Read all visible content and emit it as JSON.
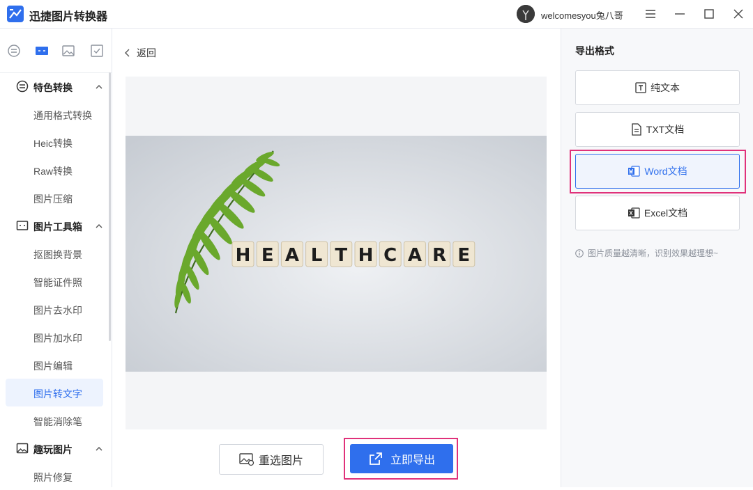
{
  "app": {
    "title": "迅捷图片转换器",
    "username": "welcomesyou兔八哥"
  },
  "window_controls": [
    "menu-icon",
    "minimize-icon",
    "maximize-icon",
    "close-icon"
  ],
  "sidebar": {
    "top_icons": [
      "convert-icon",
      "toolbox-icon",
      "image-fun-icon",
      "checklist-icon"
    ],
    "groups": [
      {
        "label": "特色转换",
        "icon": "convert-icon",
        "items": [
          "通用格式转换",
          "Heic转换",
          "Raw转换",
          "图片压缩"
        ]
      },
      {
        "label": "图片工具箱",
        "icon": "toolbox-icon",
        "items": [
          "抠图换背景",
          "智能证件照",
          "图片去水印",
          "图片加水印",
          "图片编辑",
          "图片转文字",
          "智能消除笔"
        ]
      },
      {
        "label": "趣玩图片",
        "icon": "image-fun-icon",
        "items": [
          "照片修复"
        ]
      }
    ],
    "active_item": "图片转文字"
  },
  "main": {
    "back_label": "返回",
    "photo_text": "HEALTHCARE",
    "reselect_label": "重选图片",
    "export_label": "立即导出"
  },
  "right_panel": {
    "title": "导出格式",
    "formats": [
      {
        "label": "纯文本",
        "icon": "text-icon"
      },
      {
        "label": "TXT文档",
        "icon": "txt-file-icon"
      },
      {
        "label": "Word文档",
        "icon": "word-icon"
      },
      {
        "label": "Excel文档",
        "icon": "excel-icon"
      }
    ],
    "selected_format": "Word文档",
    "tip": "图片质量越清晰，识别效果越理想~"
  },
  "colors": {
    "accent": "#2f6fed",
    "highlight": "#e0317a",
    "active_bg": "#edf3fe"
  }
}
